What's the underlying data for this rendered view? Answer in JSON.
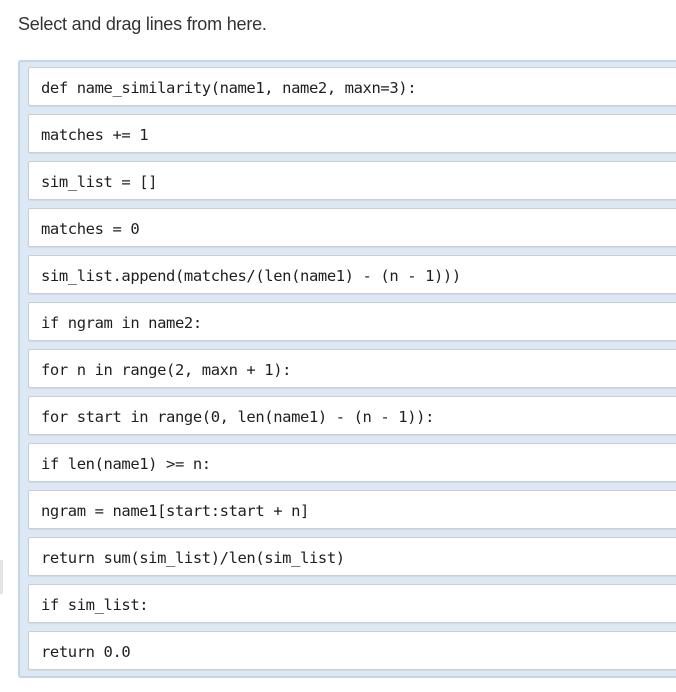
{
  "instruction": "Select and drag lines from here.",
  "colors": {
    "panel_background": "#dce8f3",
    "panel_border": "#c3d5e8",
    "block_background": "#ffffff",
    "block_border": "#c9ced4"
  },
  "blocks": [
    {
      "code": "def name_similarity(name1, name2, maxn=3):"
    },
    {
      "code": "matches += 1"
    },
    {
      "code": "sim_list = []"
    },
    {
      "code": "matches = 0"
    },
    {
      "code": "sim_list.append(matches/(len(name1) - (n - 1)))"
    },
    {
      "code": "if ngram in name2:"
    },
    {
      "code": "for n in range(2, maxn + 1):"
    },
    {
      "code": "for start in range(0, len(name1) - (n - 1)):"
    },
    {
      "code": "if len(name1) >= n:"
    },
    {
      "code": "ngram = name1[start:start + n]"
    },
    {
      "code": "return sum(sim_list)/len(sim_list)"
    },
    {
      "code": "if sim_list:"
    },
    {
      "code": "return 0.0"
    }
  ]
}
